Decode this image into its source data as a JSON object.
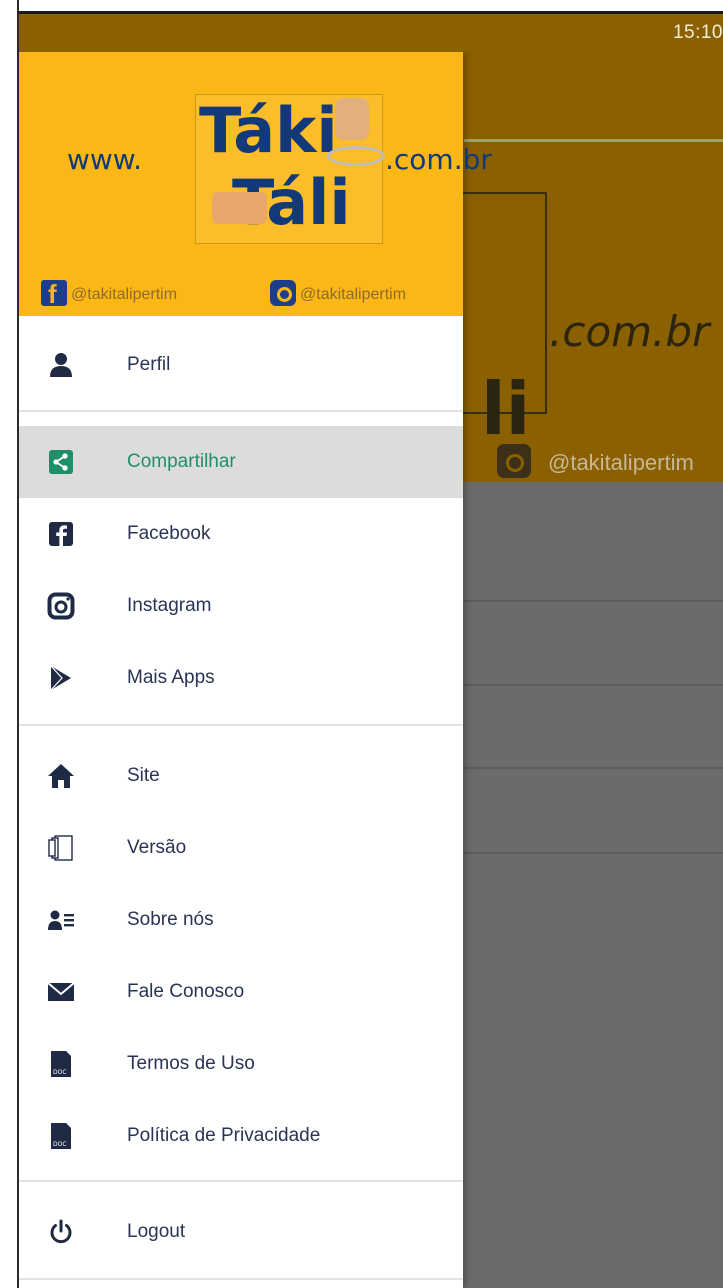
{
  "status_bar": {
    "time": "15:10"
  },
  "background_app": {
    "logo_domain_suffix": ".com.br",
    "logo_partial_word": "li",
    "instagram_handle": "@takitalipertim"
  },
  "drawer": {
    "header": {
      "logo": {
        "prefix": "www.",
        "word1": "Táki",
        "word2": "Táli",
        "suffix": ".com.br"
      },
      "facebook_handle": "@takitalipertim",
      "instagram_handle": "@takitalipertim",
      "background_color": "#fbb716"
    },
    "menu": [
      {
        "label": "Perfil",
        "icon": "person-icon"
      },
      {
        "label": "Compartilhar",
        "icon": "share-icon",
        "active": true
      },
      {
        "label": "Facebook",
        "icon": "facebook-icon"
      },
      {
        "label": "Instagram",
        "icon": "instagram-icon"
      },
      {
        "label": "Mais Apps",
        "icon": "play-store-icon"
      },
      {
        "label": "Site",
        "icon": "home-icon"
      },
      {
        "label": "Versão",
        "icon": "version-icon"
      },
      {
        "label": "Sobre nós",
        "icon": "about-icon"
      },
      {
        "label": "Fale Conosco",
        "icon": "mail-icon"
      },
      {
        "label": "Termos de Uso",
        "icon": "document-icon"
      },
      {
        "label": "Política de Privacidade",
        "icon": "document-icon"
      },
      {
        "label": "Logout",
        "icon": "power-icon"
      }
    ],
    "accent_color": "#1f8f6a",
    "text_color": "#2a3454"
  }
}
